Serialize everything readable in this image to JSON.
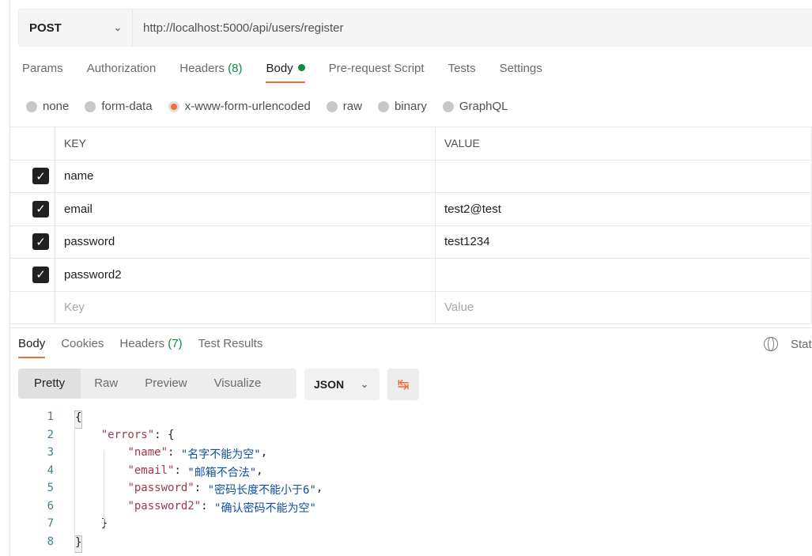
{
  "request": {
    "method": "POST",
    "url": "http://localhost:5000/api/users/register"
  },
  "tabs": [
    {
      "label": "Params"
    },
    {
      "label": "Authorization"
    },
    {
      "label": "Headers",
      "count": "(8)"
    },
    {
      "label": "Body"
    },
    {
      "label": "Pre-request Script"
    },
    {
      "label": "Tests"
    },
    {
      "label": "Settings"
    }
  ],
  "body_types": [
    {
      "label": "none"
    },
    {
      "label": "form-data"
    },
    {
      "label": "x-www-form-urlencoded",
      "selected": true
    },
    {
      "label": "raw"
    },
    {
      "label": "binary"
    },
    {
      "label": "GraphQL"
    }
  ],
  "table": {
    "headers": [
      "KEY",
      "VALUE"
    ],
    "rows": [
      {
        "key": "name",
        "value": "",
        "checked": true
      },
      {
        "key": "email",
        "value": "test2@test",
        "checked": true
      },
      {
        "key": "password",
        "value": "test1234",
        "checked": true
      },
      {
        "key": "password2",
        "value": "",
        "checked": true
      }
    ],
    "placeholder_key": "Key",
    "placeholder_value": "Value"
  },
  "response": {
    "tabs": [
      {
        "label": "Body"
      },
      {
        "label": "Cookies"
      },
      {
        "label": "Headers",
        "count": "(7)"
      },
      {
        "label": "Test Results"
      }
    ],
    "status_label": "Stat",
    "views": [
      "Pretty",
      "Raw",
      "Preview",
      "Visualize"
    ],
    "format": "JSON"
  },
  "code": {
    "lines": [
      "1",
      "2",
      "3",
      "4",
      "5",
      "6",
      "7",
      "8"
    ],
    "errors_key": "\"errors\"",
    "entries": [
      {
        "k": "\"name\"",
        "v": "\"名字不能为空\""
      },
      {
        "k": "\"email\"",
        "v": "\"邮箱不合法\""
      },
      {
        "k": "\"password\"",
        "v": "\"密码长度不能小于6\""
      },
      {
        "k": "\"password2\"",
        "v": "\"确认密码不能为空\""
      }
    ]
  },
  "colors": {
    "accent": "#f26b3a",
    "green": "#0f8a3e"
  }
}
